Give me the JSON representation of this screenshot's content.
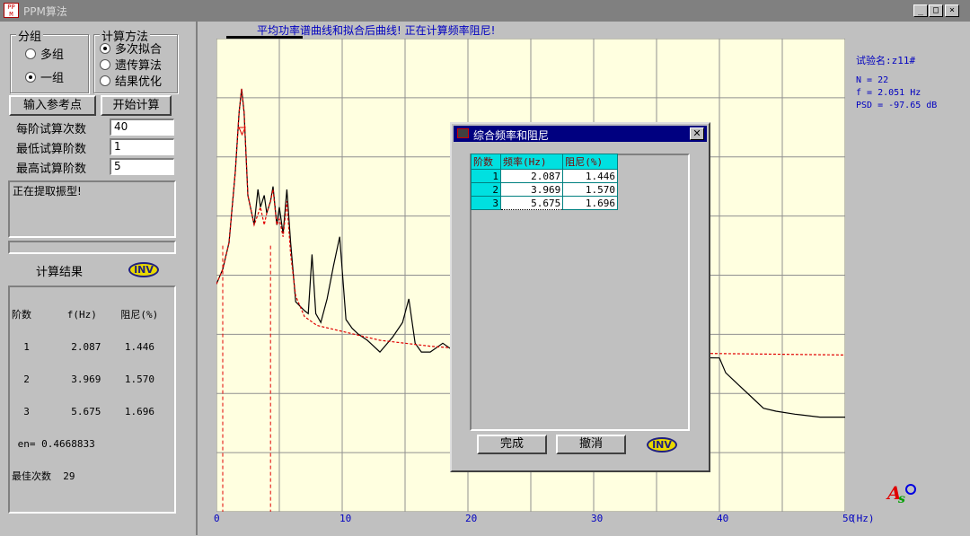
{
  "window": {
    "title": "PPM算法",
    "minimize_label": "_",
    "maximize_label": "□",
    "close_label": "×"
  },
  "grouping": {
    "caption": "分组",
    "options": [
      "多组",
      "一组"
    ],
    "selected": "一组"
  },
  "method": {
    "caption": "计算方法",
    "options": [
      "多次拟合",
      "遗传算法",
      "结果优化"
    ],
    "selected": "多次拟合"
  },
  "buttons": {
    "input_ref": "输入参考点",
    "start": "开始计算"
  },
  "params": [
    {
      "label": "每阶试算次数",
      "value": "40"
    },
    {
      "label": "最低试算阶数",
      "value": "1"
    },
    {
      "label": "最高试算阶数",
      "value": "5"
    }
  ],
  "status_text": "正在提取振型!",
  "result_title": "计算结果",
  "inv_label": "INV",
  "results_text": [
    "阶数      f(Hz)    阻尼(%)",
    "  1       2.087    1.446",
    "  2       3.969    1.570",
    "  3       5.675    1.696",
    " en= 0.4668833",
    "最佳次数  29"
  ],
  "chart_title": "平均功率谱曲线和拟合后曲线!  正在计算频率阻尼!",
  "info": {
    "test_name": "试验名:z11#",
    "n": "N = 22",
    "f": "f = 2.051 Hz",
    "psd": "PSD = -97.65 dB"
  },
  "chart_data": {
    "type": "line",
    "x_unit": "(Hz)",
    "xlim": [
      0,
      50
    ],
    "xticks": [
      "0",
      "10",
      "20",
      "30",
      "40",
      "50"
    ],
    "grid": true,
    "series": [
      {
        "color": "#000000",
        "style": "solid",
        "x": [
          0,
          0.5,
          1,
          1.5,
          1.8,
          2.0,
          2.2,
          2.5,
          3.0,
          3.3,
          3.5,
          3.8,
          4.0,
          4.3,
          4.5,
          4.8,
          5.0,
          5.3,
          5.6,
          5.9,
          6.3,
          7.0,
          7.3,
          7.6,
          7.9,
          8.3,
          8.8,
          9.3,
          9.8,
          10.3,
          10.8,
          11.3,
          12.0,
          13.0,
          14.0,
          14.8,
          15.3,
          15.8,
          16.3,
          17.0,
          18.0,
          19.0,
          20.0,
          40.0,
          40.5,
          41.5,
          42.5,
          43.5,
          44.5,
          46.0,
          48.0,
          50.0
        ],
        "y": [
          -138,
          -133,
          -124,
          -100,
          -80,
          -72,
          -80,
          -108,
          -118,
          -106,
          -112,
          -108,
          -114,
          -110,
          -105,
          -118,
          -112,
          -121,
          -106,
          -124,
          -144,
          -147,
          -148,
          -128,
          -148,
          -151,
          -143,
          -132,
          -122,
          -150,
          -153,
          -155,
          -157,
          -161,
          -156,
          -151,
          -143,
          -158,
          -161,
          -161,
          -158,
          -161,
          -162,
          -163,
          -168,
          -172,
          -176,
          -180,
          -181,
          -182,
          -183,
          -183
        ]
      },
      {
        "color": "#e00000",
        "style": "dashed",
        "x": [
          0,
          0.5,
          1,
          1.5,
          1.8,
          2.0,
          2.2,
          2.5,
          3.0,
          3.5,
          3.8,
          4.0,
          4.3,
          4.5,
          4.8,
          5.0,
          5.3,
          5.6,
          5.9,
          6.3,
          7.0,
          8.0,
          10.0,
          13.0,
          17.0,
          20.0,
          30.0,
          40.0,
          50.0
        ],
        "y": [
          -138,
          -133,
          -124,
          -100,
          -80,
          -72,
          -80,
          -108,
          -118,
          -112,
          -118,
          -114,
          -110,
          -106,
          -118,
          -116,
          -122,
          -110,
          -128,
          -142,
          -149,
          -152,
          -154,
          -157,
          -159,
          -160,
          -161,
          -161.5,
          -162
        ]
      }
    ],
    "markers_x": [
      0.5,
      4.3
    ]
  },
  "dialog": {
    "title": "综合频率和阻尼",
    "headers": [
      "阶数",
      "频率(Hz)",
      "阻尼(%)"
    ],
    "rows": [
      {
        "idx": "1",
        "freq": "2.087",
        "damp": "1.446"
      },
      {
        "idx": "2",
        "freq": "3.969",
        "damp": "1.570"
      },
      {
        "idx": "3",
        "freq": "5.675",
        "damp": "1.696"
      }
    ],
    "done_label": "完成",
    "cancel_label": "撤消",
    "inv_label": "INV"
  }
}
